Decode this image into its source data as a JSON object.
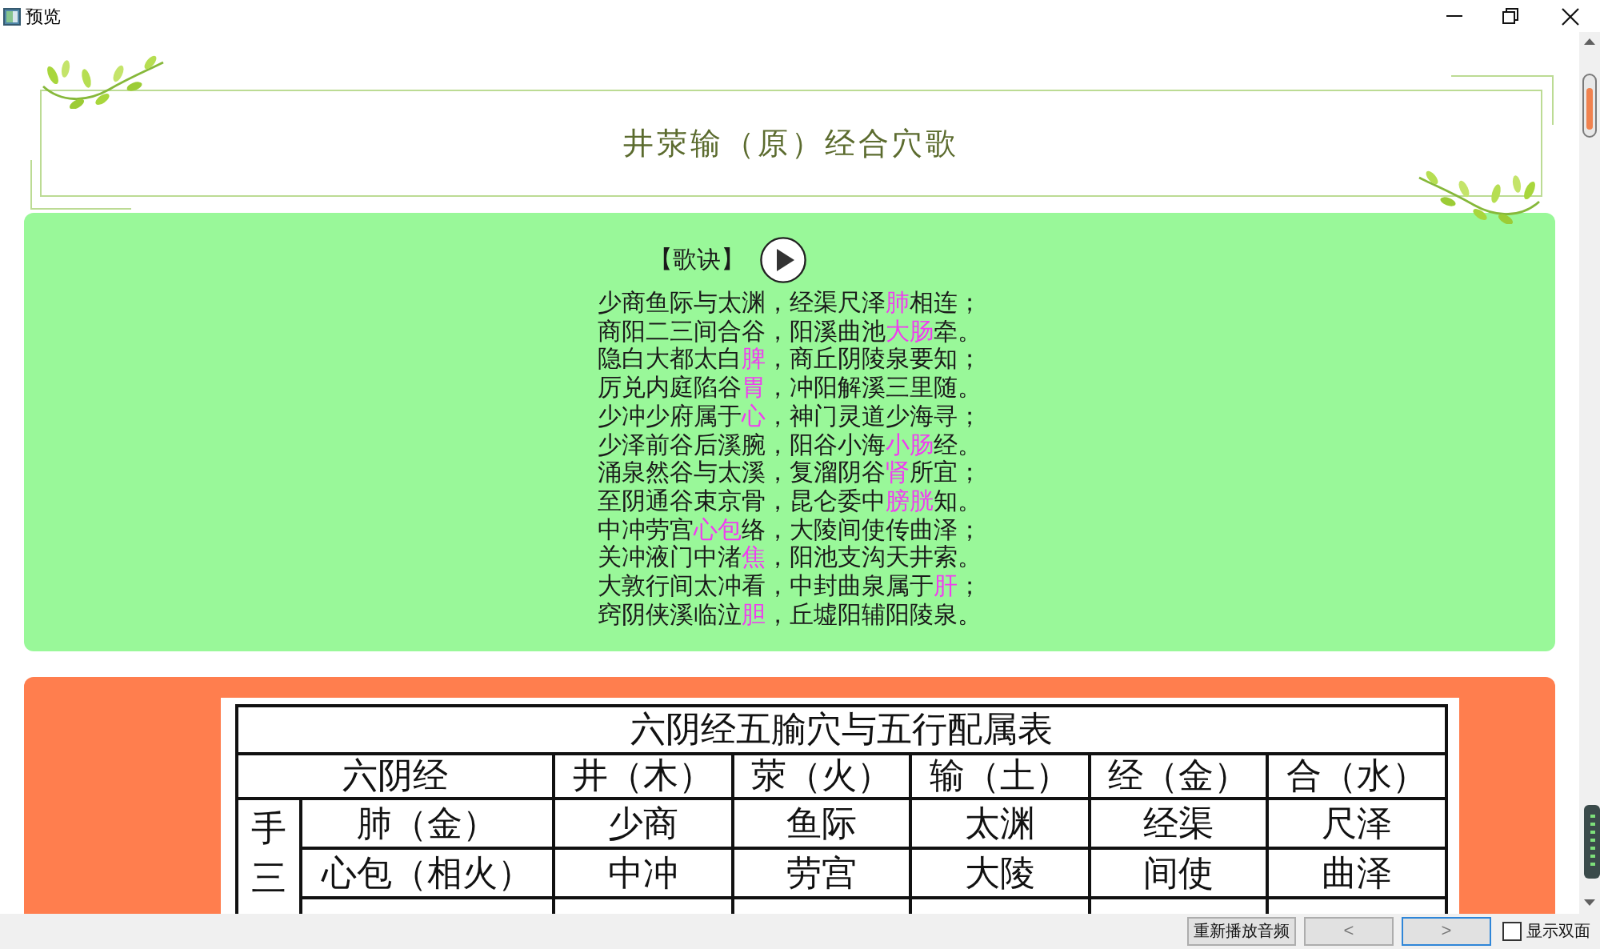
{
  "window": {
    "title": "预览"
  },
  "header": {
    "title": "井荥输（原）经合穴歌"
  },
  "verse_card": {
    "heading": "【歌诀】",
    "lines": [
      [
        {
          "text": "少商鱼际与太渊，经渠尺泽",
          "highlight": false
        },
        {
          "text": "肺",
          "highlight": true
        },
        {
          "text": "相连；",
          "highlight": false
        }
      ],
      [
        {
          "text": "商阳二三间合谷，阳溪曲池",
          "highlight": false
        },
        {
          "text": "大肠",
          "highlight": true
        },
        {
          "text": "牵。",
          "highlight": false
        }
      ],
      [
        {
          "text": "隐白大都太白",
          "highlight": false
        },
        {
          "text": "脾",
          "highlight": true
        },
        {
          "text": "，商丘阴陵泉要知；",
          "highlight": false
        }
      ],
      [
        {
          "text": "厉兑内庭陷谷",
          "highlight": false
        },
        {
          "text": "胃",
          "highlight": true
        },
        {
          "text": "，冲阳解溪三里随。",
          "highlight": false
        }
      ],
      [
        {
          "text": "少冲少府属于",
          "highlight": false
        },
        {
          "text": "心",
          "highlight": true
        },
        {
          "text": "，神门灵道少海寻；",
          "highlight": false
        }
      ],
      [
        {
          "text": "少泽前谷后溪腕，阳谷小海",
          "highlight": false
        },
        {
          "text": "小肠",
          "highlight": true
        },
        {
          "text": "经。",
          "highlight": false
        }
      ],
      [
        {
          "text": "涌泉然谷与太溪，复溜阴谷",
          "highlight": false
        },
        {
          "text": "肾",
          "highlight": true
        },
        {
          "text": "所宜；",
          "highlight": false
        }
      ],
      [
        {
          "text": "至阴通谷束京骨，昆仑委中",
          "highlight": false
        },
        {
          "text": "膀胱",
          "highlight": true
        },
        {
          "text": "知。",
          "highlight": false
        }
      ],
      [
        {
          "text": "中冲劳宫",
          "highlight": false
        },
        {
          "text": "心包",
          "highlight": true
        },
        {
          "text": "络，大陵间使传曲泽；",
          "highlight": false
        }
      ],
      [
        {
          "text": "关冲液门中渚",
          "highlight": false
        },
        {
          "text": "焦",
          "highlight": true
        },
        {
          "text": "，阳池支沟天井索。",
          "highlight": false
        }
      ],
      [
        {
          "text": "大敦行间太冲看，中封曲泉属于",
          "highlight": false
        },
        {
          "text": "肝",
          "highlight": true
        },
        {
          "text": "；",
          "highlight": false
        }
      ],
      [
        {
          "text": "窍阴侠溪临泣",
          "highlight": false
        },
        {
          "text": "胆",
          "highlight": true
        },
        {
          "text": "，丘墟阳辅阳陵泉。",
          "highlight": false
        }
      ]
    ]
  },
  "table_card": {
    "table": {
      "title": "六阴经五腧穴与五行配属表",
      "columns": [
        "六阴经",
        "井（木）",
        "荥（火）",
        "输（土）",
        "经（金）",
        "合（水）"
      ],
      "group_label": "手三",
      "rows": [
        {
          "meridian": "肺（金）",
          "points": [
            "少商",
            "鱼际",
            "太渊",
            "经渠",
            "尺泽"
          ]
        },
        {
          "meridian": "心包（相火）",
          "points": [
            "中冲",
            "劳宫",
            "大陵",
            "间使",
            "曲泽"
          ]
        }
      ]
    }
  },
  "bottom_bar": {
    "buttons": [
      {
        "label": "重新播放音频",
        "focused": false
      },
      {
        "label": "<",
        "focused": false
      },
      {
        "label": ">",
        "focused": true
      }
    ],
    "checkbox": {
      "label": "显示双面",
      "checked": false
    }
  }
}
